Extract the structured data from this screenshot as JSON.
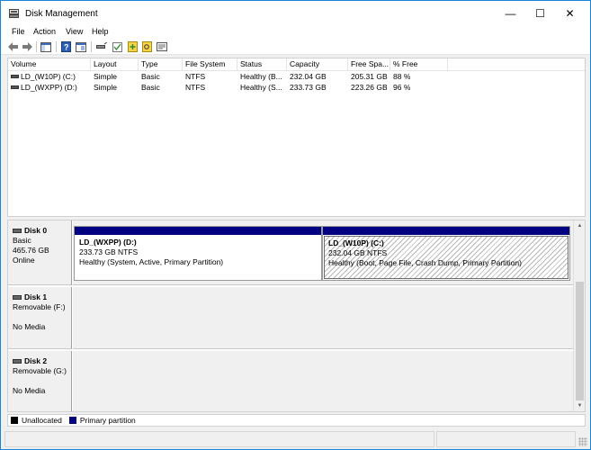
{
  "window": {
    "title": "Disk Management",
    "min_glyph": "—",
    "max_glyph": "☐",
    "close_glyph": "✕"
  },
  "menu": [
    "File",
    "Action",
    "View",
    "Help"
  ],
  "toolbar": {
    "icons": [
      "back-icon",
      "forward-icon",
      "console-tree-icon",
      "help-icon",
      "properties-icon",
      "connect-icon",
      "check-icon",
      "new-volume-icon",
      "find-icon",
      "settings-icon"
    ]
  },
  "volume_list": {
    "columns": [
      "Volume",
      "Layout",
      "Type",
      "File System",
      "Status",
      "Capacity",
      "Free Spa...",
      "% Free"
    ],
    "rows": [
      [
        "LD_(W10P) (C:)",
        "Simple",
        "Basic",
        "NTFS",
        "Healthy (B...",
        "232.04 GB",
        "205.31 GB",
        "88 %"
      ],
      [
        "LD_(WXPP) (D:)",
        "Simple",
        "Basic",
        "NTFS",
        "Healthy (S...",
        "233.73 GB",
        "223.26 GB",
        "96 %"
      ]
    ]
  },
  "disks": [
    {
      "name": "Disk 0",
      "lines": [
        "Basic",
        "465.76 GB",
        "Online"
      ],
      "partitions": [
        {
          "name": "LD_(WXPP)  (D:)",
          "size": "233.73 GB NTFS",
          "status": "Healthy (System, Active, Primary Partition)"
        },
        {
          "name": "LD_(W10P)  (C:)",
          "size": "232.04 GB NTFS",
          "status": "Healthy (Boot, Page File, Crash Dump, Primary Partition)"
        }
      ]
    },
    {
      "name": "Disk 1",
      "lines": [
        "Removable (F:)",
        "",
        "No Media"
      ]
    },
    {
      "name": "Disk 2",
      "lines": [
        "Removable (G:)",
        "",
        "No Media"
      ]
    }
  ],
  "legend": [
    {
      "label": "Unallocated",
      "color": "#000000"
    },
    {
      "label": "Primary partition",
      "color": "#000080"
    }
  ],
  "colors": {
    "primary_partition": "#000080",
    "window_border": "#1883d7"
  }
}
